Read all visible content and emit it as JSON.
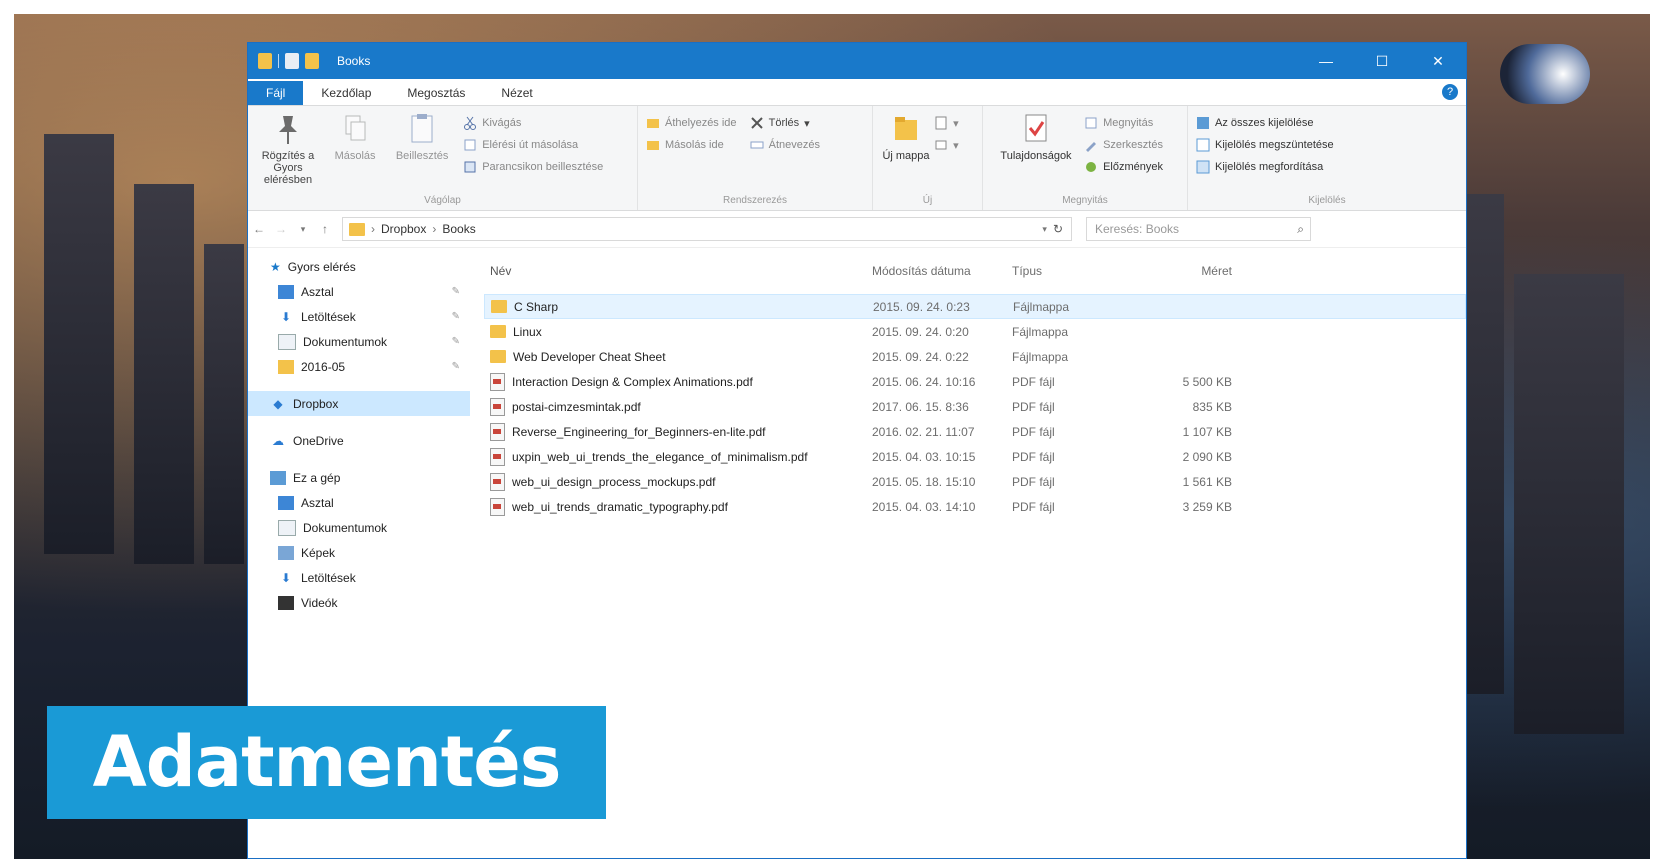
{
  "window": {
    "title": "Books",
    "controls": {
      "minimize": "—",
      "maximize": "☐",
      "close": "✕"
    }
  },
  "tabs": [
    "Fájl",
    "Kezdőlap",
    "Megosztás",
    "Nézet"
  ],
  "help_label": "?",
  "ribbon": {
    "vagolap": {
      "label": "Vágólap",
      "pin": "Rögzítés a Gyors elérésben",
      "copy": "Másolás",
      "paste": "Beillesztés",
      "cut": "Kivágás",
      "copy_path": "Elérési út másolása",
      "paste_shortcut": "Parancsikon beillesztése"
    },
    "rendszerezes": {
      "label": "Rendszerezés",
      "move_to": "Áthelyezés ide",
      "copy_to": "Másolás ide",
      "delete": "Törlés",
      "rename": "Átnevezés"
    },
    "uj": {
      "label": "Új",
      "new_folder": "Új mappa"
    },
    "megnyitas": {
      "label": "Megnyitás",
      "properties": "Tulajdonságok",
      "open": "Megnyitás",
      "edit": "Szerkesztés",
      "history": "Előzmények"
    },
    "kijeloles": {
      "label": "Kijelölés",
      "select_all": "Az összes kijelölése",
      "select_none": "Kijelölés megszüntetése",
      "invert": "Kijelölés megfordítása"
    }
  },
  "address": {
    "path": [
      "Dropbox",
      "Books"
    ],
    "refresh": "↻",
    "search_placeholder": "Keresés: Books"
  },
  "sidebar": {
    "quick_access": "Gyors elérés",
    "quick_items": [
      "Asztal",
      "Letöltések",
      "Dokumentumok",
      "2016-05"
    ],
    "dropbox": "Dropbox",
    "onedrive": "OneDrive",
    "this_pc": "Ez a gép",
    "pc_items": [
      "Asztal",
      "Dokumentumok",
      "Képek",
      "Letöltések",
      "Videók"
    ]
  },
  "columns": {
    "name": "Név",
    "date": "Módosítás dátuma",
    "type": "Típus",
    "size": "Méret"
  },
  "files": [
    {
      "name": "C Sharp",
      "date": "2015. 09. 24. 0:23",
      "type": "Fájlmappa",
      "size": "",
      "kind": "folder"
    },
    {
      "name": "Linux",
      "date": "2015. 09. 24. 0:20",
      "type": "Fájlmappa",
      "size": "",
      "kind": "folder"
    },
    {
      "name": "Web Developer Cheat Sheet",
      "date": "2015. 09. 24. 0:22",
      "type": "Fájlmappa",
      "size": "",
      "kind": "folder"
    },
    {
      "name": "Interaction Design & Complex Animations.pdf",
      "date": "2015. 06. 24. 10:16",
      "type": "PDF fájl",
      "size": "5 500 KB",
      "kind": "pdf"
    },
    {
      "name": "postai-cimzesmintak.pdf",
      "date": "2017. 06. 15. 8:36",
      "type": "PDF fájl",
      "size": "835 KB",
      "kind": "pdf"
    },
    {
      "name": "Reverse_Engineering_for_Beginners-en-lite.pdf",
      "date": "2016. 02. 21. 11:07",
      "type": "PDF fájl",
      "size": "1 107 KB",
      "kind": "pdf"
    },
    {
      "name": "uxpin_web_ui_trends_the_elegance_of_minimalism.pdf",
      "date": "2015. 04. 03. 10:15",
      "type": "PDF fájl",
      "size": "2 090 KB",
      "kind": "pdf"
    },
    {
      "name": "web_ui_design_process_mockups.pdf",
      "date": "2015. 05. 18. 15:10",
      "type": "PDF fájl",
      "size": "1 561 KB",
      "kind": "pdf"
    },
    {
      "name": "web_ui_trends_dramatic_typography.pdf",
      "date": "2015. 04. 03. 14:10",
      "type": "PDF fájl",
      "size": "3 259 KB",
      "kind": "pdf"
    }
  ],
  "banner": "Adatmentés",
  "colors": {
    "accent": "#1979ca",
    "banner": "#1a9ad6",
    "folder": "#f3c24a"
  }
}
